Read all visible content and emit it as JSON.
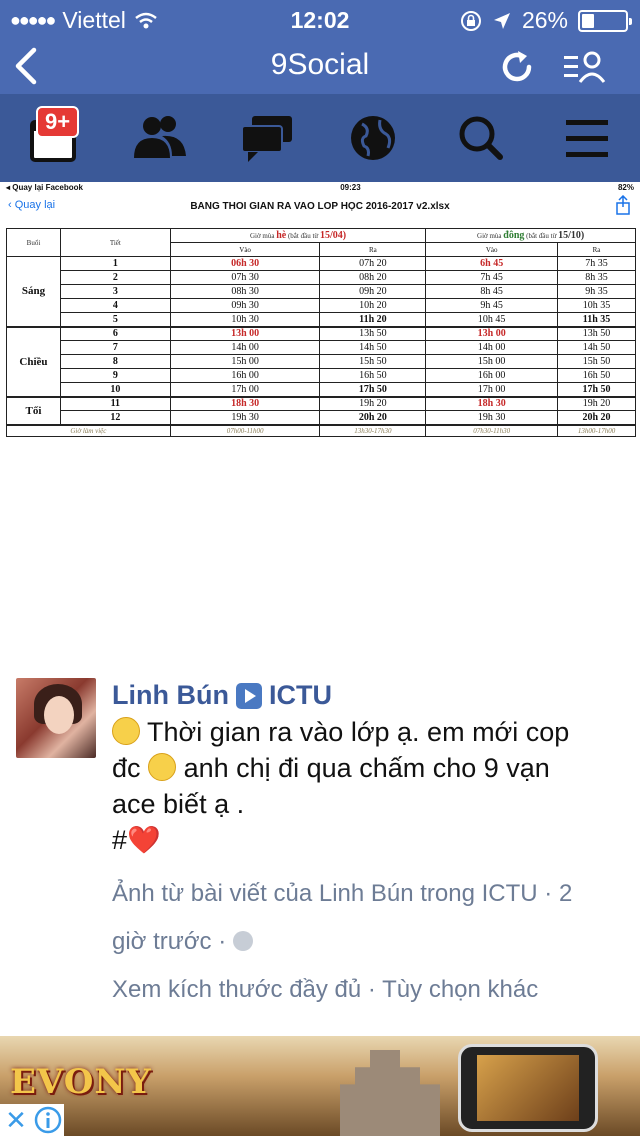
{
  "status_bar": {
    "carrier": "Viettel",
    "time": "12:02",
    "battery": "26%",
    "battery_level": 0.26
  },
  "header": {
    "title": "9Social",
    "back_icon": "chevron-left-icon",
    "refresh_icon": "refresh-icon",
    "menu_icon": "friends-list-icon"
  },
  "nav": {
    "badge": "9+",
    "items": [
      "calendar-icon",
      "friends-icon",
      "messages-icon",
      "globe-icon",
      "search-icon",
      "menu-icon"
    ]
  },
  "schedule_image": {
    "status_left": "◂ Quay lại Facebook",
    "status_time": "09:23",
    "status_battery": "82%",
    "back_label": "Quay lại",
    "file_name": "BANG THOI GIAN RA VAO LOP HỌC 2016-2017 v2.xlsx",
    "col_buoi": "Buổi",
    "col_tiet": "Tiết",
    "summer_prefix": "Giờ mùa",
    "summer_word": "hè",
    "summer_note": "(bắt đầu từ",
    "summer_date": "15/04)",
    "winter_prefix": "Giờ mùa",
    "winter_word": "đông",
    "winter_note": "(bắt đầu từ",
    "winter_date": "15/10)",
    "vao": "Vào",
    "ra": "Ra",
    "sessions": [
      "Sáng",
      "Chiều",
      "Tối"
    ],
    "rows": [
      [
        "1",
        "06h 30",
        "07h 20",
        "6h 45",
        "7h 35"
      ],
      [
        "2",
        "07h 30",
        "08h 20",
        "7h 45",
        "8h 35"
      ],
      [
        "3",
        "08h 30",
        "09h 20",
        "8h 45",
        "9h 35"
      ],
      [
        "4",
        "09h 30",
        "10h 20",
        "9h 45",
        "10h 35"
      ],
      [
        "5",
        "10h 30",
        "11h 20",
        "10h 45",
        "11h 35"
      ],
      [
        "6",
        "13h 00",
        "13h 50",
        "13h 00",
        "13h 50"
      ],
      [
        "7",
        "14h 00",
        "14h 50",
        "14h 00",
        "14h 50"
      ],
      [
        "8",
        "15h 00",
        "15h 50",
        "15h 00",
        "15h 50"
      ],
      [
        "9",
        "16h 00",
        "16h 50",
        "16h 00",
        "16h 50"
      ],
      [
        "10",
        "17h 00",
        "17h 50",
        "17h 00",
        "17h 50"
      ],
      [
        "11",
        "18h 30",
        "19h 20",
        "18h 30",
        "19h 20"
      ],
      [
        "12",
        "19h 30",
        "20h 20",
        "19h 30",
        "20h 20"
      ]
    ],
    "footer_label": "Giờ làm việc",
    "footer": [
      "07h00-11h00",
      "13h30-17h30",
      "07h30-11h30",
      "13h00-17h00"
    ]
  },
  "post": {
    "author": "Linh Bún",
    "group": "ICTU",
    "line1": "Thời gian ra vào lớp ạ. em mới cop",
    "line2a": "đc",
    "line2b": "anh chị đi qua chấm cho 9 vạn",
    "line3": "ace biết ạ .",
    "line4": "#",
    "heart": "❤️",
    "meta1": "Ảnh từ bài viết của Linh Bún trong ICTU · 2",
    "meta2": "giờ trước ·",
    "meta3": "Xem kích thước đầy đủ · Tùy chọn khác"
  },
  "ad": {
    "brand": "EVONY",
    "close": "✕"
  },
  "colors": {
    "header_bg": "#4a6ab2",
    "nav_bg": "#3b5998",
    "link": "#3b5998",
    "meta": "#6d7c95",
    "red": "#c62828",
    "green": "#2e7d32"
  }
}
